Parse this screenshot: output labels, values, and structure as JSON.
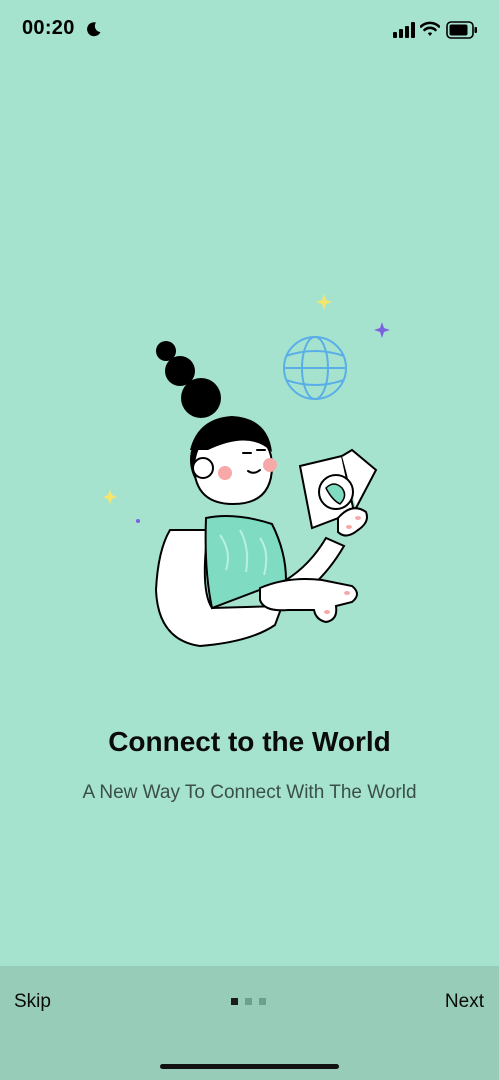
{
  "status_bar": {
    "time": "00:20",
    "icons": [
      "moon-icon",
      "signal-icon",
      "wifi-icon",
      "battery-icon"
    ]
  },
  "onboarding": {
    "illustration": "woman-holding-passport-with-globe",
    "title": "Connect to the World",
    "subtitle": "A New Way To Connect With The World"
  },
  "footer": {
    "skip_label": "Skip",
    "next_label": "Next",
    "pages_total": 3,
    "current_page": 1
  },
  "colors": {
    "background": "#a6e3cf",
    "footer_background": "#97ccb9",
    "dot_active": "#1c1c1c",
    "dot_inactive": "#6e9e8f",
    "globe": "#5aaee8",
    "sparkle_purple": "#7b63e0",
    "sparkle_yellow": "#f5e66b"
  }
}
